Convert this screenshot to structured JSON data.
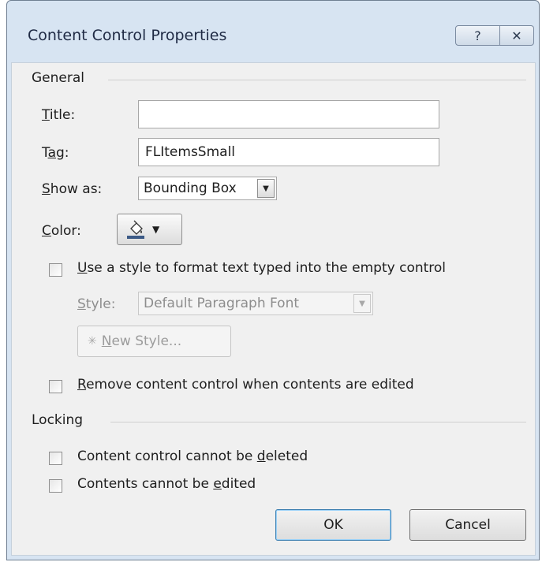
{
  "dialog": {
    "title": "Content Control Properties",
    "help_glyph": "?",
    "close_glyph": "✕"
  },
  "general": {
    "group_label": "General",
    "title_label_u": "T",
    "title_label_rest": "itle:",
    "title_value": "",
    "tag_label_pre": "T",
    "tag_label_u": "a",
    "tag_label_rest": "g:",
    "tag_value": "FLItemsSmall",
    "show_as_label_u": "S",
    "show_as_label_rest": "how as:",
    "show_as_value": "Bounding Box",
    "color_label_u": "C",
    "color_label_rest": "olor:",
    "use_style_checked": false,
    "use_style_label_u": "U",
    "use_style_label_rest": "se a style to format text typed into the empty control",
    "style_label_u": "S",
    "style_label_rest": "tyle:",
    "style_value": "Default Paragraph Font",
    "new_style_label_u": "N",
    "new_style_label_rest": "ew Style...",
    "remove_checked": false,
    "remove_label_u": "R",
    "remove_label_rest": "emove content control when contents are edited"
  },
  "locking": {
    "group_label": "Locking",
    "cannot_delete_checked": false,
    "cannot_delete_pre": "Content control cannot be ",
    "cannot_delete_u": "d",
    "cannot_delete_rest": "eleted",
    "cannot_edit_checked": false,
    "cannot_edit_pre": "Contents cannot be ",
    "cannot_edit_u": "e",
    "cannot_edit_rest": "dited"
  },
  "buttons": {
    "ok_label": "OK",
    "cancel_label": "Cancel"
  }
}
